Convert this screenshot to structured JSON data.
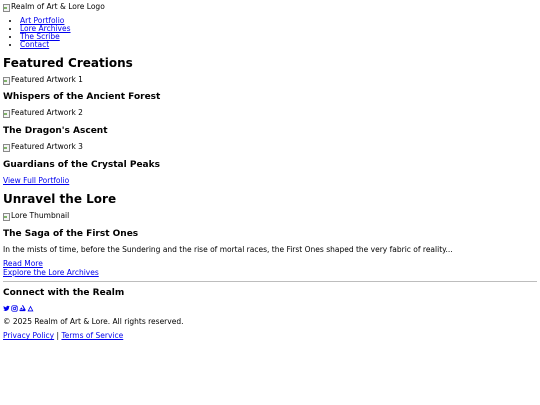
{
  "header": {
    "logo_alt": "Realm of Art & Lore Logo",
    "nav": [
      {
        "label": "Art Portfolio"
      },
      {
        "label": "Lore Archives"
      },
      {
        "label": "The Scribe"
      },
      {
        "label": "Contact"
      }
    ]
  },
  "featured": {
    "heading": "Featured Creations",
    "items": [
      {
        "image_alt": "Featured Artwork 1",
        "title": "Whispers of the Ancient Forest"
      },
      {
        "image_alt": "Featured Artwork 2",
        "title": "The Dragon's Ascent"
      },
      {
        "image_alt": "Featured Artwork 3",
        "title": "Guardians of the Crystal Peaks"
      }
    ],
    "portfolio_link": "View Full Portfolio"
  },
  "lore": {
    "heading": "Unravel the Lore",
    "thumb_alt": "Lore Thumbnail",
    "title": "The Saga of the First Ones",
    "excerpt": "In the mists of time, before the Sundering and the rise of mortal races, the First Ones shaped the very fabric of reality...",
    "read_more": "Read More",
    "archives_link": "Explore the Lore Archives"
  },
  "footer": {
    "heading": "Connect with the Realm",
    "social_icons": [
      "twitter-icon",
      "instagram-icon",
      "artstation-icon",
      "deviantart-icon"
    ],
    "copyright": "© 2025 Realm of Art & Lore. All rights reserved.",
    "privacy": "Privacy Policy",
    "separator": "|",
    "terms": "Terms of Service"
  },
  "colors": {
    "link": "#0000ee",
    "text": "#000000",
    "rule": "#bdbdbd"
  }
}
